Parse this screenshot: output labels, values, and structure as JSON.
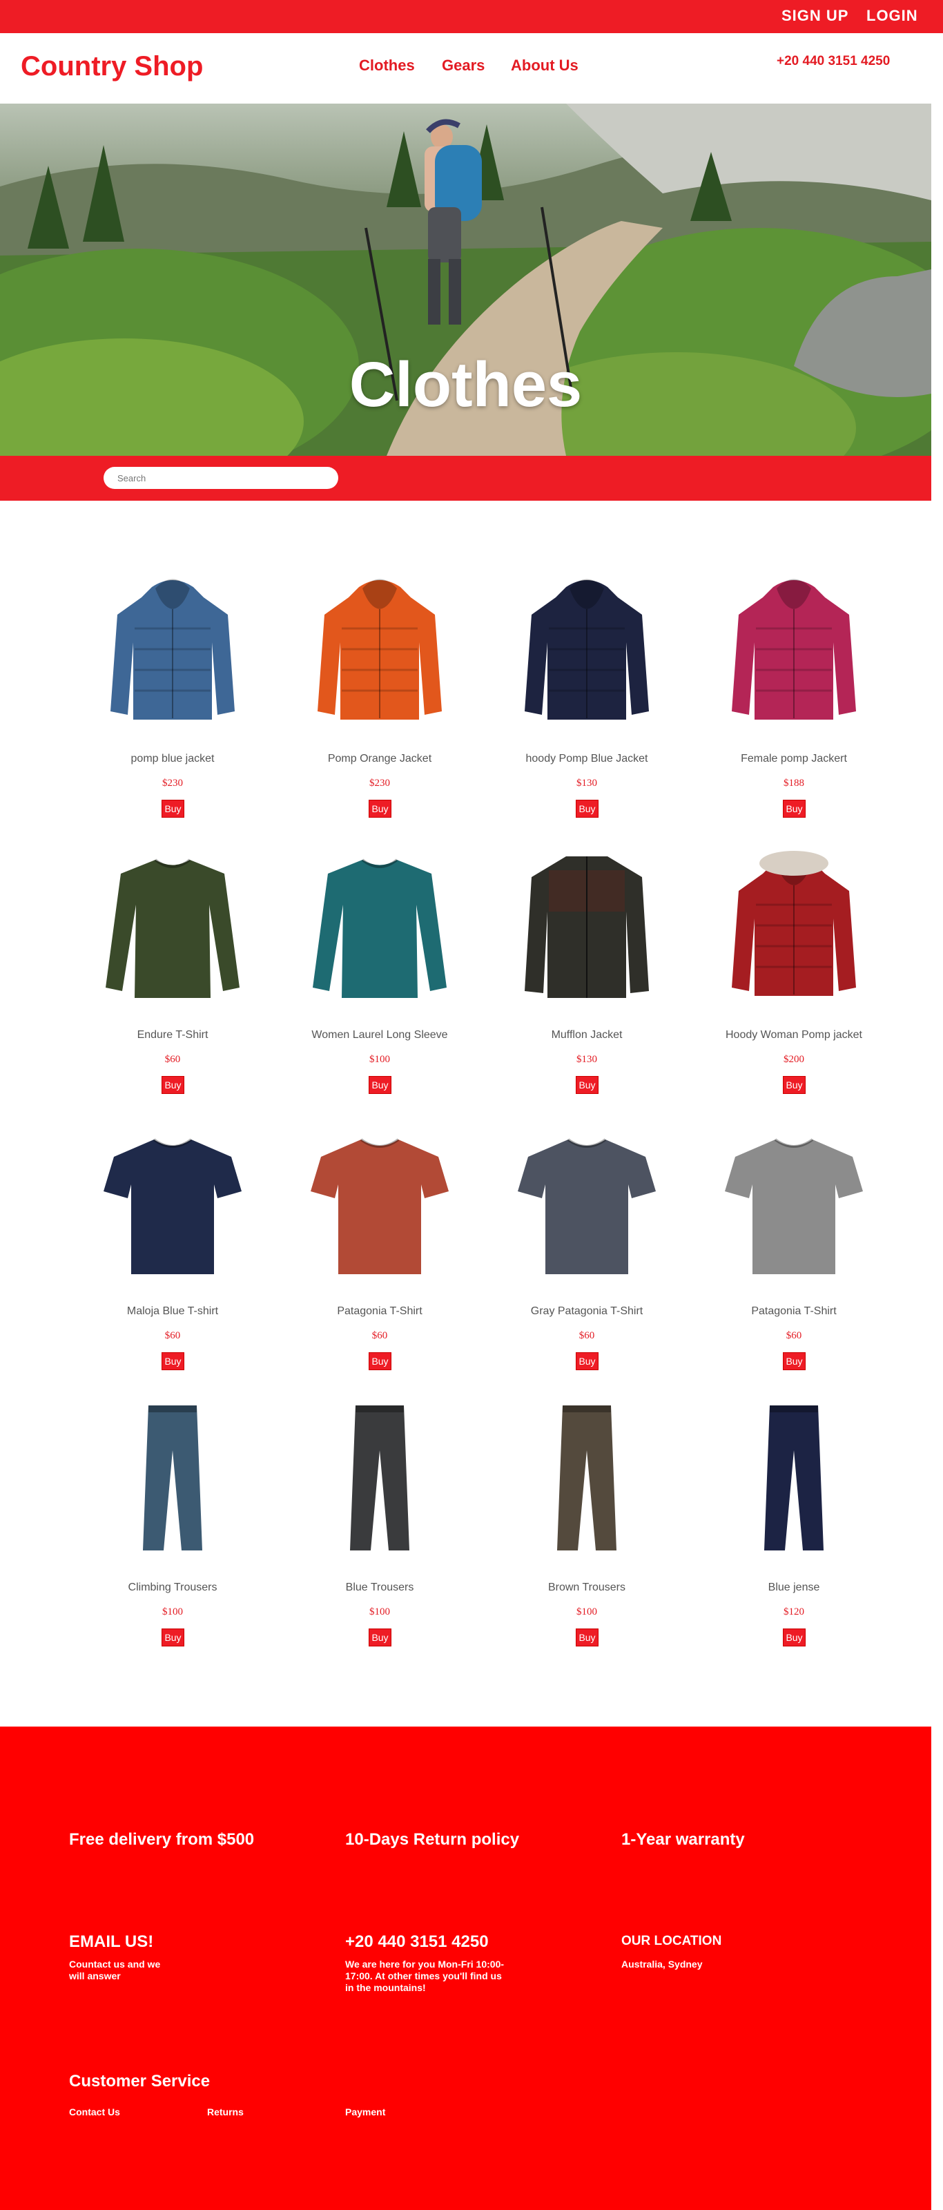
{
  "topbar": {
    "signup": "SIGN UP",
    "login": "LOGIN"
  },
  "header": {
    "logo": "Country Shop",
    "nav": [
      "Clothes",
      "Gears",
      "About Us"
    ],
    "phone": "+20 440 3151 4250"
  },
  "hero": {
    "title": "Clothes"
  },
  "search": {
    "placeholder": "Search"
  },
  "buy_label": "Buy",
  "products": [
    {
      "name": "pomp blue jacket",
      "price": "$230",
      "icon": "down-jacket-icon",
      "color": "#3e6796"
    },
    {
      "name": "Pomp Orange Jacket",
      "price": "$230",
      "icon": "down-jacket-icon",
      "color": "#e2571c"
    },
    {
      "name": "hoody Pomp Blue Jacket",
      "price": "$130",
      "icon": "down-jacket-icon",
      "color": "#1d2340"
    },
    {
      "name": "Female pomp Jackert",
      "price": "$188",
      "icon": "down-jacket-icon",
      "color": "#b42556"
    },
    {
      "name": "Endure T-Shirt",
      "price": "$60",
      "icon": "long-sleeve-shirt-icon",
      "color": "#3a4a2a"
    },
    {
      "name": "Women Laurel Long Sleeve",
      "price": "$100",
      "icon": "long-sleeve-shirt-icon",
      "color": "#1e6b72"
    },
    {
      "name": "Mufflon Jacket",
      "price": "$130",
      "icon": "fleece-jacket-icon",
      "color": "#2f2f29"
    },
    {
      "name": "Hoody Woman Pomp jacket",
      "price": "$200",
      "icon": "parka-icon",
      "color": "#a51d21"
    },
    {
      "name": "Maloja Blue T-shirt",
      "price": "$60",
      "icon": "t-shirt-icon",
      "color": "#1f2a4a"
    },
    {
      "name": "Patagonia T-Shirt",
      "price": "$60",
      "icon": "t-shirt-icon",
      "color": "#b24a36"
    },
    {
      "name": "Gray Patagonia T-Shirt",
      "price": "$60",
      "icon": "t-shirt-icon",
      "color": "#4d5361"
    },
    {
      "name": "Patagonia T-Shirt",
      "price": "$60",
      "icon": "t-shirt-icon",
      "color": "#8c8c8c"
    },
    {
      "name": "Climbing Trousers",
      "price": "$100",
      "icon": "trousers-icon",
      "color": "#3c5a72"
    },
    {
      "name": "Blue Trousers",
      "price": "$100",
      "icon": "trousers-icon",
      "color": "#3a3b3d"
    },
    {
      "name": "Brown Trousers",
      "price": "$100",
      "icon": "trousers-icon",
      "color": "#544a3d"
    },
    {
      "name": "Blue jense",
      "price": "$120",
      "icon": "trousers-icon",
      "color": "#1c2344"
    }
  ],
  "footer": {
    "features": [
      "Free delivery from $500",
      "10-Days Return policy",
      "1-Year warranty"
    ],
    "email": {
      "title": "EMAIL US!",
      "text": [
        "Countact us and we",
        "will answer"
      ]
    },
    "phone": {
      "title": "+20 440 3151 4250",
      "text": [
        "We are here for you Mon-Fri 10:00-",
        "17:00. At other times you'll find us",
        "in the mountains!"
      ]
    },
    "location": {
      "title": "OUR LOCATION",
      "text": [
        "Australia, Sydney"
      ]
    },
    "customer_service": {
      "title": "Customer Service",
      "links": [
        "Contact Us",
        "Returns",
        "Payment"
      ]
    }
  },
  "colors": {
    "brand": "#ee1c25",
    "footer": "#ff0000"
  }
}
